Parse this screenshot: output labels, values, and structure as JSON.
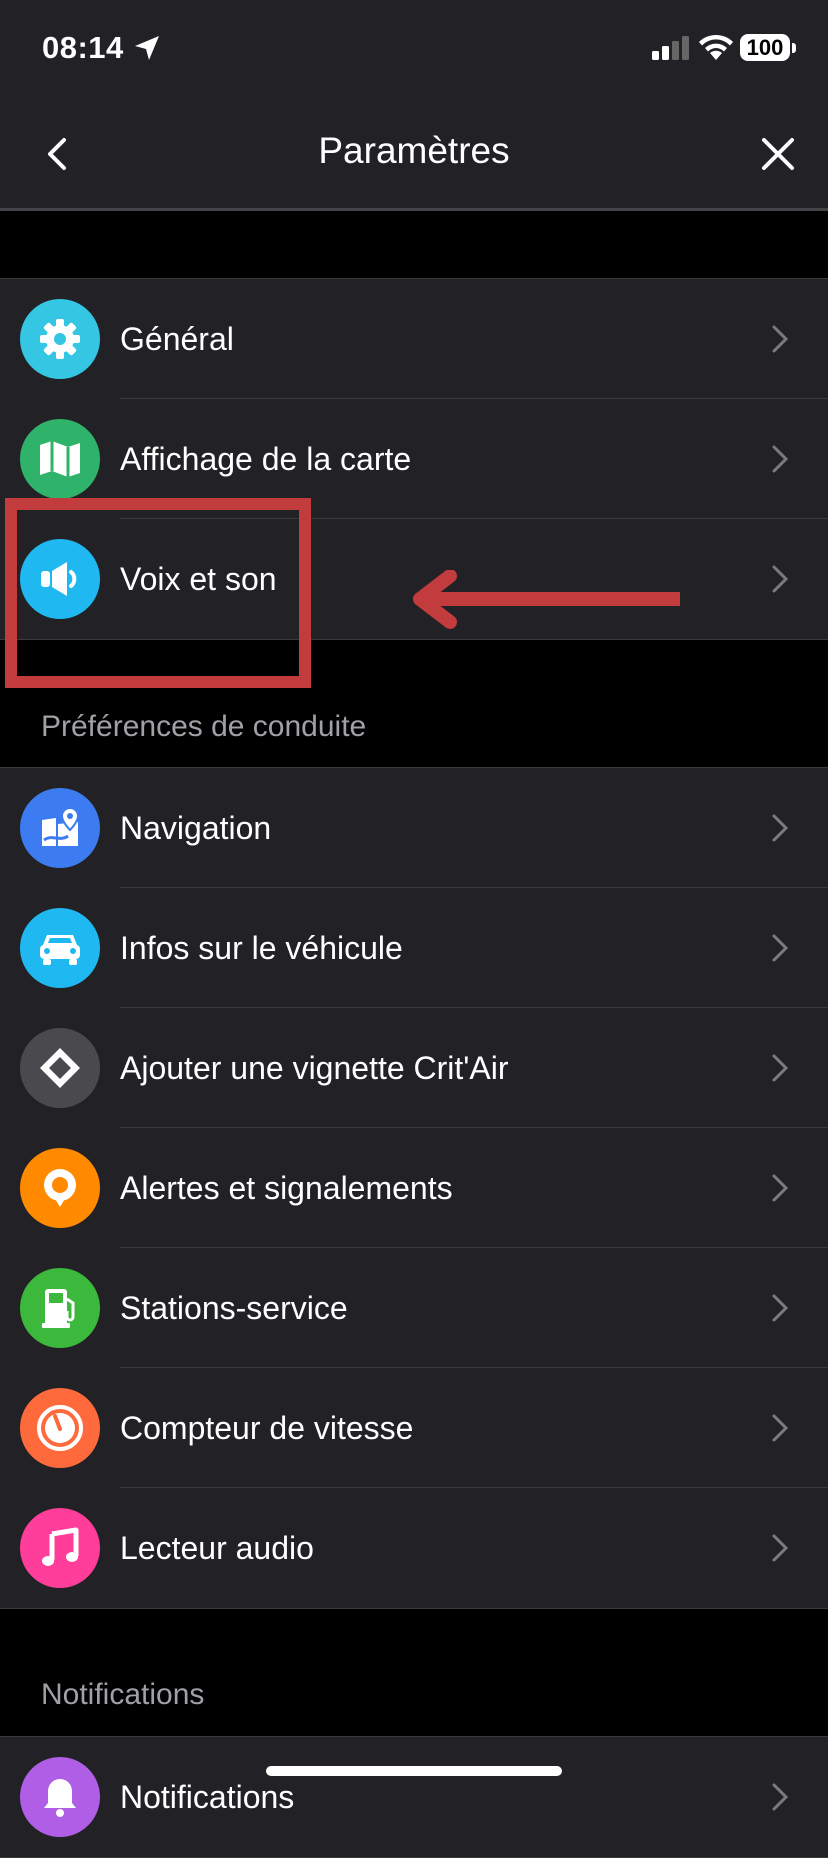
{
  "status": {
    "time": "08:14",
    "battery": "100"
  },
  "header": {
    "title": "Paramètres"
  },
  "group1": {
    "items": [
      {
        "label": "Général",
        "icon": "gear-icon",
        "color": "#35c6e3"
      },
      {
        "label": "Affichage de la carte",
        "icon": "map-icon",
        "color": "#2fb36b"
      },
      {
        "label": "Voix et son",
        "icon": "speaker-icon",
        "color": "#1fb8f0"
      }
    ]
  },
  "section_driving": {
    "header": "Préférences de conduite",
    "items": [
      {
        "label": "Navigation",
        "icon": "navigation-map-icon",
        "color": "#3d7cf0"
      },
      {
        "label": "Infos sur le véhicule",
        "icon": "car-icon",
        "color": "#1fb8f0"
      },
      {
        "label": "Ajouter une vignette Crit'Air",
        "icon": "diamond-icon",
        "color": "#4a4a4e"
      },
      {
        "label": "Alertes et signalements",
        "icon": "alert-pin-icon",
        "color": "#ff8a00"
      },
      {
        "label": "Stations-service",
        "icon": "fuel-pump-icon",
        "color": "#3cb83c"
      },
      {
        "label": "Compteur de vitesse",
        "icon": "speedometer-icon",
        "color": "#ff6a3d"
      },
      {
        "label": "Lecteur audio",
        "icon": "music-note-icon",
        "color": "#ff3d9a"
      }
    ]
  },
  "section_notifications": {
    "header": "Notifications",
    "items": [
      {
        "label": "Notifications",
        "icon": "bell-icon",
        "color": "#b05ee6"
      }
    ]
  },
  "colors": {
    "background": "#000000",
    "surface": "#222226",
    "annotation": "#c23b3d"
  }
}
